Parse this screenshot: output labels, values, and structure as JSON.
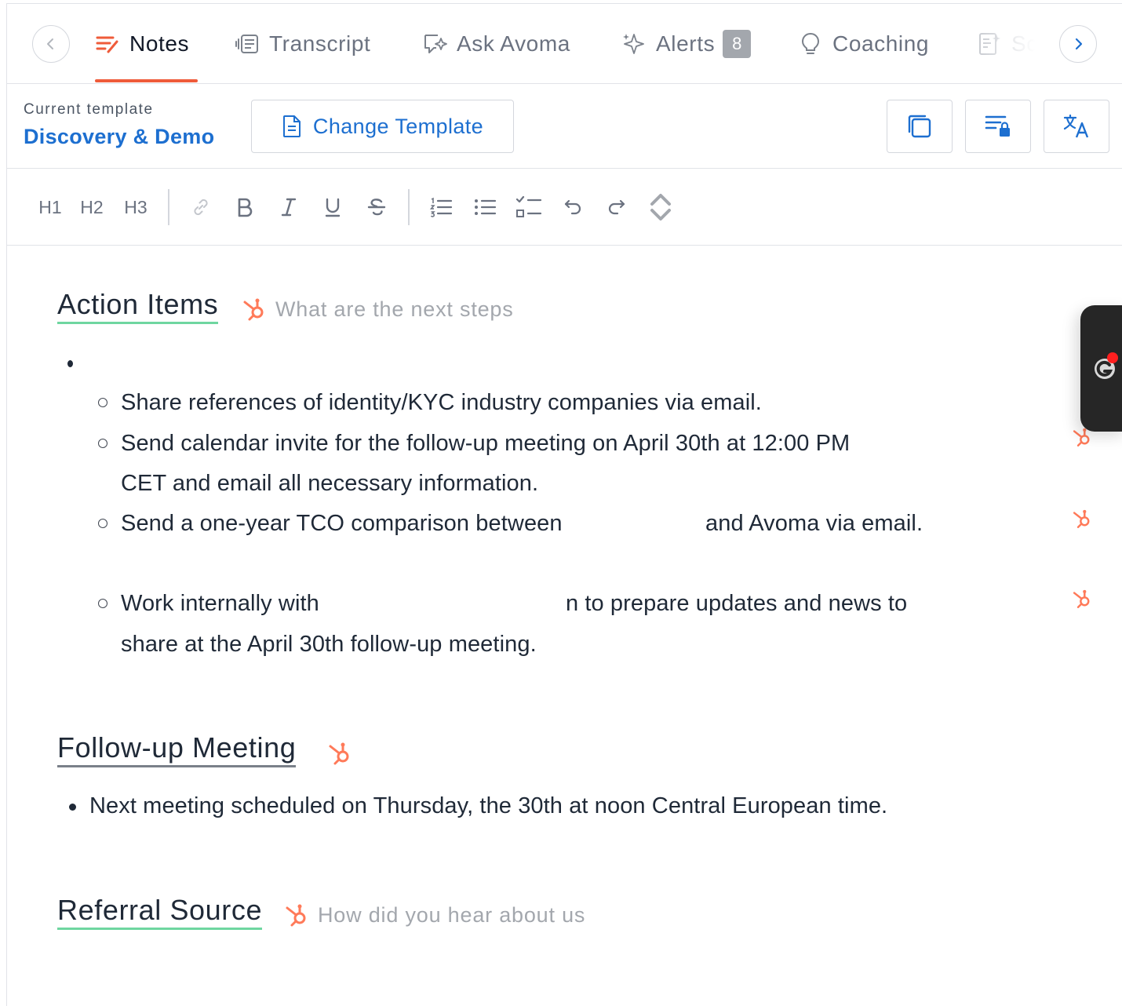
{
  "tabs": {
    "items": [
      {
        "label": "Notes",
        "icon": "notes-icon",
        "active": true
      },
      {
        "label": "Transcript",
        "icon": "transcript-icon"
      },
      {
        "label": "Ask Avoma",
        "icon": "ask-avoma-icon"
      },
      {
        "label": "Alerts",
        "icon": "sparkle-icon",
        "badge": "8"
      },
      {
        "label": "Coaching",
        "icon": "lightbulb-icon"
      },
      {
        "label": "Sc",
        "icon": "scorecard-icon"
      }
    ],
    "accent_color": "#ef5b3a"
  },
  "template": {
    "caption": "Current template",
    "name": "Discovery & Demo",
    "change_label": "Change Template"
  },
  "toolbar": {
    "h1": "H1",
    "h2": "H2",
    "h3": "H3"
  },
  "notes": {
    "action_items": {
      "title": "Action Items",
      "hint": "What are the next steps",
      "items": [
        "Share references of identity/KYC industry companies via email.",
        "Send calendar invite for the follow-up meeting on April 30th at 12:00 PM",
        "CET and email all necessary information.",
        "Send a one-year TCO comparison between",
        "and Avoma via email.",
        "Work internally with",
        "n to prepare updates and news to",
        "share at the April 30th follow-up meeting."
      ]
    },
    "follow_up": {
      "title": "Follow-up Meeting",
      "items": [
        "Next meeting scheduled on Thursday, the 30th at noon Central European time."
      ]
    },
    "referral": {
      "title": "Referral Source",
      "hint": "How did you hear about us"
    }
  },
  "colors": {
    "link_blue": "#1d6fd0",
    "hubspot_orange": "#ff7a59",
    "heading_underline_green": "#6fd6a0"
  }
}
